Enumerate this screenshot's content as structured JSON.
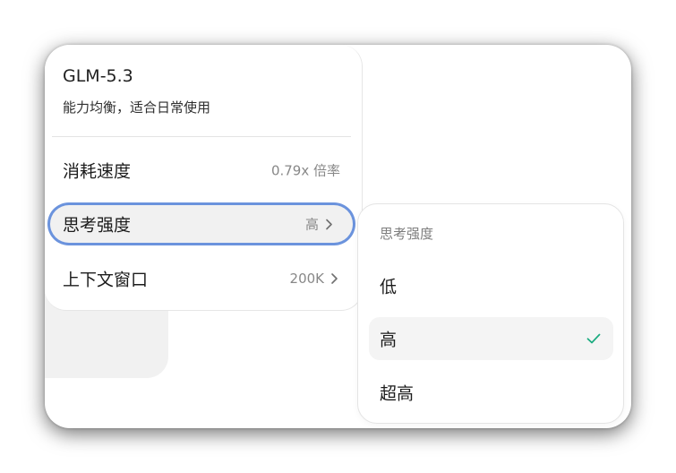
{
  "model": {
    "name": "GLM-5.3",
    "description": "能力均衡，适合日常使用"
  },
  "menu": {
    "items": [
      {
        "label": "消耗速度",
        "value": "0.79x 倍率",
        "has_submenu": false
      },
      {
        "label": "思考强度",
        "value": "高",
        "has_submenu": true,
        "focused": true
      },
      {
        "label": "上下文窗口",
        "value": "200K",
        "has_submenu": true
      }
    ]
  },
  "submenu": {
    "title": "思考强度",
    "options": [
      {
        "label": "低",
        "selected": false
      },
      {
        "label": "高",
        "selected": true
      },
      {
        "label": "超高",
        "selected": false
      }
    ]
  },
  "colors": {
    "focus_ring": "#6b93dd",
    "check": "#1aab7f",
    "selected_bg": "#f4f4f4"
  },
  "icons": {
    "chevron": "chevron-right-icon",
    "check": "check-icon"
  }
}
